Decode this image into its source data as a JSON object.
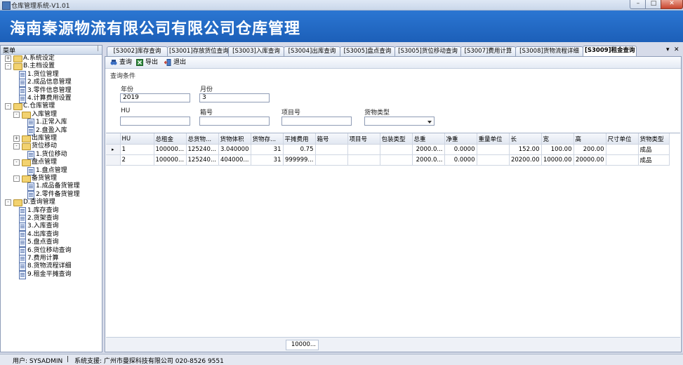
{
  "window": {
    "title": "仓库管理系统-V1.01"
  },
  "banner": {
    "title": "海南秦源物流有限公司有限公司仓库管理"
  },
  "menu": {
    "header": "菜单",
    "pin": "ᛁ",
    "nodes": [
      {
        "label": "A.系统设定",
        "type": "folder",
        "level": 0,
        "expander": "+"
      },
      {
        "label": "B.主档设置",
        "type": "folder",
        "level": 0,
        "expander": "-"
      },
      {
        "label": "1.货位管理",
        "type": "doc",
        "level": 1
      },
      {
        "label": "2.成品信息管理",
        "type": "doc",
        "level": 1
      },
      {
        "label": "3.零件信息管理",
        "type": "doc",
        "level": 1
      },
      {
        "label": "4.计算费用设置",
        "type": "doc",
        "level": 1
      },
      {
        "label": "C.仓库管理",
        "type": "folder",
        "level": 0,
        "expander": "-"
      },
      {
        "label": "入库管理",
        "type": "folder",
        "level": 1,
        "expander": "-"
      },
      {
        "label": "1.正常入库",
        "type": "doc",
        "level": 2
      },
      {
        "label": "2.盘盈入库",
        "type": "doc",
        "level": 2
      },
      {
        "label": "出库管理",
        "type": "folder",
        "level": 1,
        "expander": "+"
      },
      {
        "label": "货位移动",
        "type": "folder",
        "level": 1,
        "expander": "-"
      },
      {
        "label": "1.货位移动",
        "type": "doc",
        "level": 2
      },
      {
        "label": "盘点管理",
        "type": "folder",
        "level": 1,
        "expander": "-"
      },
      {
        "label": "1.盘点管理",
        "type": "doc",
        "level": 2
      },
      {
        "label": "备货管理",
        "type": "folder",
        "level": 1,
        "expander": "-"
      },
      {
        "label": "1.成品备货管理",
        "type": "doc",
        "level": 2
      },
      {
        "label": "2.零件备货管理",
        "type": "doc",
        "level": 2
      },
      {
        "label": "D.查询管理",
        "type": "folder",
        "level": 0,
        "expander": "-"
      },
      {
        "label": "1.库存查询",
        "type": "doc",
        "level": 1
      },
      {
        "label": "2.货架查询",
        "type": "doc",
        "level": 1
      },
      {
        "label": "3.入库查询",
        "type": "doc",
        "level": 1
      },
      {
        "label": "4.出库查询",
        "type": "doc",
        "level": 1
      },
      {
        "label": "5.盘点查询",
        "type": "doc",
        "level": 1
      },
      {
        "label": "6.货位移动查询",
        "type": "doc",
        "level": 1
      },
      {
        "label": "7.费用计算",
        "type": "doc",
        "level": 1
      },
      {
        "label": "8.货物流程详细",
        "type": "doc",
        "level": 1
      },
      {
        "label": "9.租金平摊查询",
        "type": "doc",
        "level": 1
      }
    ]
  },
  "tabs": [
    {
      "label": "[S3002]库存查询",
      "active": false
    },
    {
      "label": "[S3001]存放货位查询",
      "active": false
    },
    {
      "label": "[S3003]入库查询",
      "active": false
    },
    {
      "label": "[S3004]出库查询",
      "active": false
    },
    {
      "label": "[S3005]盘点查询",
      "active": false
    },
    {
      "label": "[S3005]货位移动查询",
      "active": false
    },
    {
      "label": "[S3007]费用计算",
      "active": false
    },
    {
      "label": "[S3008]货物流程详细",
      "active": false
    },
    {
      "label": "[S3009]租金查询",
      "active": true
    }
  ],
  "tab_controls": {
    "dropdown": "▾",
    "close": "✕"
  },
  "toolbar": {
    "query": "查询",
    "export": "导出",
    "exit": "退出"
  },
  "conditions": {
    "title": "查询条件",
    "year_label": "年份",
    "year_value": "2019",
    "month_label": "月份",
    "month_value": "3",
    "hu_label": "HU",
    "hu_value": "",
    "box_label": "箱号",
    "box_value": "",
    "item_label": "项目号",
    "item_value": "",
    "goods_type_label": "货物类型",
    "goods_type_value": ""
  },
  "grid": {
    "columns": [
      "",
      "HU",
      "总租金",
      "总货物...",
      "货物体积",
      "货物存...",
      "平摊费用",
      "箱号",
      "项目号",
      "包装类型",
      "总重",
      "净重",
      "重量单位",
      "长",
      "宽",
      "高",
      "尺寸单位",
      "货物类型"
    ],
    "rows": [
      [
        "▸",
        "1",
        "100000...",
        "125240...",
        "3.040000",
        "31",
        "0.75",
        "",
        "",
        "",
        "2000.0...",
        "0.0000",
        "",
        "152.00",
        "100.00",
        "200.00",
        "",
        "成品"
      ],
      [
        "",
        "2",
        "100000...",
        "125240...",
        "404000...",
        "31",
        "999999...",
        "",
        "",
        "",
        "2000.0...",
        "0.0000",
        "",
        "20200.00",
        "10000.00",
        "20000.00",
        "",
        "成品"
      ]
    ],
    "summary": "10000..."
  },
  "status": {
    "user": "用户: SYSADMIN",
    "sep": "|",
    "support": "系统支援: 广州市曼探科技有限公司 020-8526 9551"
  }
}
